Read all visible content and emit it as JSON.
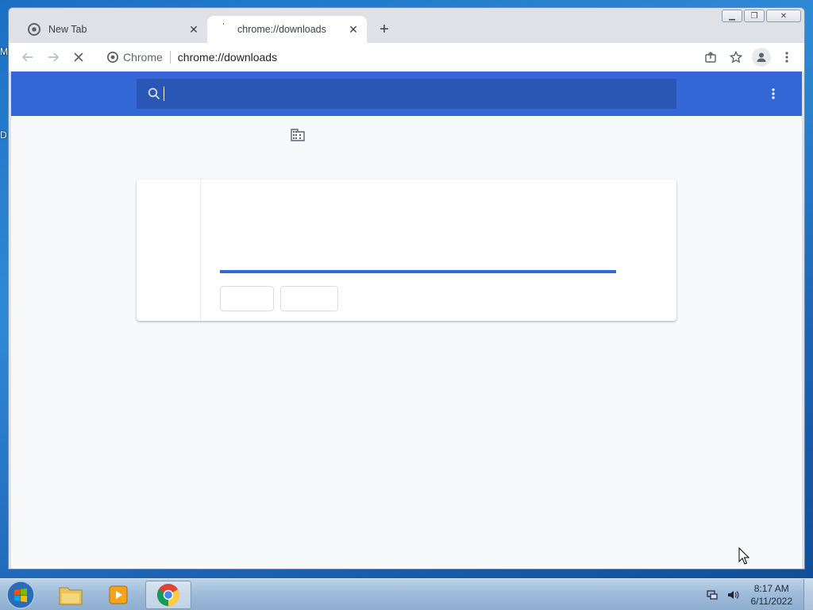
{
  "desktop": {
    "edge_labels": [
      "M",
      "D"
    ]
  },
  "browser": {
    "tabs": [
      {
        "title": "New Tab",
        "active": false
      },
      {
        "title": "chrome://downloads",
        "active": true
      }
    ],
    "omnibox": {
      "site_label": "Chrome",
      "url": "chrome://downloads"
    },
    "icons": {
      "back": "back-arrow-icon",
      "forward": "forward-arrow-icon",
      "stop": "stop-loading-icon",
      "share": "share-icon",
      "bookmark": "star-icon",
      "profile": "profile-icon",
      "menu": "kebab-menu-icon"
    }
  },
  "downloads_page": {
    "search": {
      "placeholder": "",
      "value": ""
    },
    "header_color": "#3367d6",
    "managed_icon": "building-icon",
    "item": {
      "progress": 1.0,
      "buttons": [
        "",
        ""
      ]
    }
  },
  "taskbar": {
    "apps": [
      {
        "name": "file-explorer-icon",
        "active": false
      },
      {
        "name": "media-player-icon",
        "active": false
      },
      {
        "name": "chrome-icon",
        "active": true
      }
    ],
    "clock": {
      "time": "8:17 AM",
      "date": "6/11/2022"
    }
  }
}
